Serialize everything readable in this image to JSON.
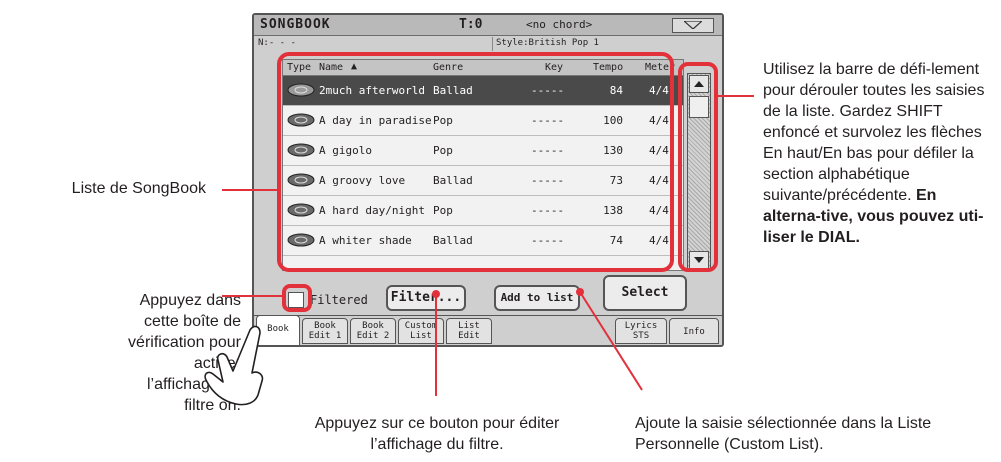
{
  "screen": {
    "title": "SONGBOOK",
    "tempo_display": "T:0",
    "chord_display": "<no chord>",
    "name_field": "N:- - -",
    "style_field": "Style:British Pop 1"
  },
  "list": {
    "columns": [
      "Type",
      "Name",
      "Genre",
      "Key",
      "Tempo",
      "Meter"
    ],
    "rows": [
      {
        "name": "2much afterworld",
        "genre": "Ballad",
        "key": "-----",
        "tempo": "84",
        "meter": "4/4",
        "selected": true
      },
      {
        "name": "A day in paradise",
        "genre": "Pop",
        "key": "-----",
        "tempo": "100",
        "meter": "4/4"
      },
      {
        "name": "A gigolo",
        "genre": "Pop",
        "key": "-----",
        "tempo": "130",
        "meter": "4/4"
      },
      {
        "name": "A groovy love",
        "genre": "Ballad",
        "key": "-----",
        "tempo": "73",
        "meter": "4/4"
      },
      {
        "name": "A hard day/night",
        "genre": "Pop",
        "key": "-----",
        "tempo": "138",
        "meter": "4/4"
      },
      {
        "name": "A whiter shade",
        "genre": "Ballad",
        "key": "-----",
        "tempo": "74",
        "meter": "4/4"
      }
    ]
  },
  "controls": {
    "filtered_label": "Filtered",
    "filter_button": "Filter...",
    "add_button": "Add to list",
    "select_button": "Select"
  },
  "tabs": [
    {
      "label": "Book",
      "active": true
    },
    {
      "label": "Book Edit 1"
    },
    {
      "label": "Book Edit 2"
    },
    {
      "label": "Custom List"
    },
    {
      "label": "List Edit"
    },
    {
      "label": "Lyrics STS"
    },
    {
      "label": "Info"
    }
  ],
  "callouts": {
    "songbook_list": "Liste de SongBook",
    "checkbox_help": "Appuyez dans cette boîte de vérification pour activer l’affichage du filtre on.",
    "scroll_help_plain": "Utilisez la barre de défi-lement pour dérouler toutes les saisies de la liste. Gardez SHIFT enfoncé et survolez les flèches En haut/En bas pour défiler la section alphabétique suivante/précédente. ",
    "scroll_help_bold": "En alterna-tive, vous pouvez uti-liser le DIAL.",
    "filter_help": "Appuyez sur ce bouton pour éditer l’affichage du filtre.",
    "add_help": "Ajoute la saisie sélectionnée dans la Liste Personnelle (Custom List)."
  },
  "colors": {
    "highlight": "#e3313c",
    "screen_bg": "#cfcfcf",
    "selected_row": "#4a4a4a"
  }
}
